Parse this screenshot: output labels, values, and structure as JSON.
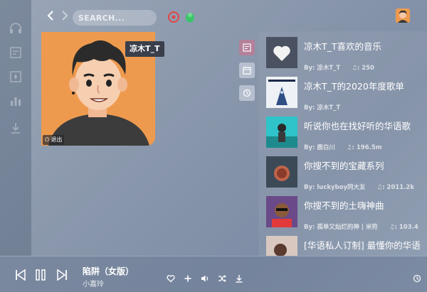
{
  "search": {
    "placeholder": "SEARCH..."
  },
  "profile": {
    "username": "凉木T_T",
    "logout_label": "退出"
  },
  "sidebar": {
    "items": [
      {
        "icon": "headphones-icon"
      },
      {
        "icon": "playlist-icon"
      },
      {
        "icon": "collection-icon"
      },
      {
        "icon": "chart-icon"
      },
      {
        "icon": "download-icon"
      }
    ]
  },
  "playlists": [
    {
      "title": "凉木T_T喜欢的音乐",
      "author": "By: 凉木T_T",
      "count": "250"
    },
    {
      "title": "凉木T_T的2020年度歌单",
      "author": "By: 凉木T_T",
      "count": ""
    },
    {
      "title": "听说你也在找好听的华语歌",
      "author": "By: 鹿白川",
      "count": "196.5m"
    },
    {
      "title": "你搜不到的宝藏系列",
      "author": "By: luckyboy同大友",
      "count": "2011.2k"
    },
    {
      "title": "你搜不到的土嗨神曲",
      "author": "By: 孤单又灿烂的神 | 米符",
      "count": "103.4"
    },
    {
      "title": "[华语私人订制] 最懂你的华语",
      "author": "",
      "count": ""
    }
  ],
  "player": {
    "song_title": "陷阱（女版）",
    "artist": "小嘉玲"
  },
  "colors": {
    "accent": "#b4809a",
    "avatar_bg": "#ee9a4e"
  }
}
